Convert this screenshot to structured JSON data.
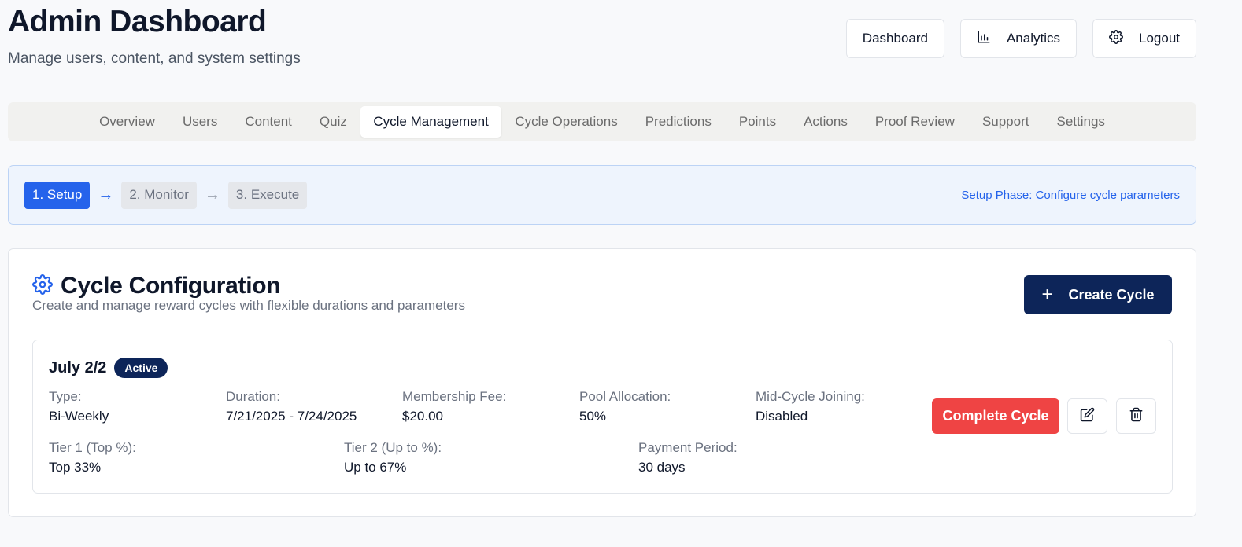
{
  "header": {
    "title": "Admin Dashboard",
    "subtitle": "Manage users, content, and system settings",
    "buttons": {
      "dashboard": "Dashboard",
      "analytics": "Analytics",
      "logout": "Logout"
    }
  },
  "tabs": [
    "Overview",
    "Users",
    "Content",
    "Quiz",
    "Cycle Management",
    "Cycle Operations",
    "Predictions",
    "Points",
    "Actions",
    "Proof Review",
    "Support",
    "Settings"
  ],
  "active_tab": "Cycle Management",
  "phases": {
    "steps": [
      "1. Setup",
      "2. Monitor",
      "3. Execute"
    ],
    "arrow": "→",
    "description": "Setup Phase: Configure cycle parameters"
  },
  "config": {
    "title": "Cycle Configuration",
    "subtitle": "Create and manage reward cycles with flexible durations and parameters",
    "create_label": "Create Cycle",
    "create_icon": "+"
  },
  "cycle": {
    "name": "July 2/2",
    "status": "Active",
    "fields": {
      "type": {
        "label": "Type:",
        "value": "Bi-Weekly"
      },
      "duration": {
        "label": "Duration:",
        "value": "7/21/2025 - 7/24/2025"
      },
      "fee": {
        "label": "Membership Fee:",
        "value": "$20.00"
      },
      "pool": {
        "label": "Pool Allocation:",
        "value": "50%"
      },
      "mid_cycle": {
        "label": "Mid-Cycle Joining:",
        "value": "Disabled"
      },
      "tier1": {
        "label": "Tier 1 (Top %):",
        "value": "Top 33%"
      },
      "tier2": {
        "label": "Tier 2 (Up to %):",
        "value": "Up to 67%"
      },
      "payment": {
        "label": "Payment Period:",
        "value": "30 days"
      }
    },
    "complete_label": "Complete Cycle"
  },
  "colors": {
    "primary": "#0d2559",
    "accent_blue": "#2563eb",
    "danger": "#ef4444"
  }
}
